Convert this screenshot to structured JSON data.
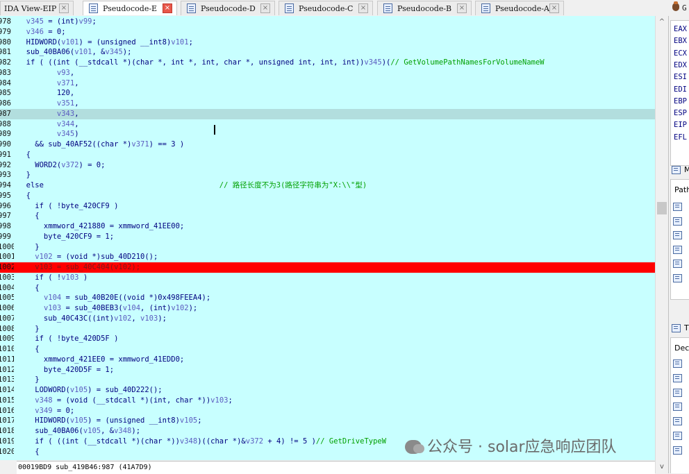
{
  "tabs": [
    {
      "label": "IDA View-EIP",
      "active": false,
      "icon": "none"
    },
    {
      "label": "Pseudocode-E",
      "active": true,
      "icon": "pseudocode-icon"
    },
    {
      "label": "Pseudocode-D",
      "active": false,
      "icon": "pseudocode-icon"
    },
    {
      "label": "Pseudocode-C",
      "active": false,
      "icon": "pseudocode-icon"
    },
    {
      "label": "Pseudocode-B",
      "active": false,
      "icon": "pseudocode-icon"
    },
    {
      "label": "Pseudocode-A",
      "active": false,
      "icon": "pseudocode-icon"
    }
  ],
  "close_glyph": "×",
  "right_top": {
    "label": "G"
  },
  "colors": {
    "code_bg": "#c8ffff",
    "breakpoint_line": "#ff0000",
    "highlight_line": "#b2dede",
    "comment": "#00a000",
    "code_text": "#000080"
  },
  "code_lines": [
    {
      "num": "978",
      "text": "  v345 = (int)v99;",
      "style": "normal"
    },
    {
      "num": "979",
      "text": "  v346 = 0;",
      "style": "normal"
    },
    {
      "num": "980",
      "text": "  HIDWORD(v101) = (unsigned __int8)v101;",
      "style": "normal"
    },
    {
      "num": "981",
      "text": "  sub_40BA06(v101, &v345);",
      "style": "normal"
    },
    {
      "num": "982",
      "text": "  if ( ((int (__stdcall *)(char *, int *, int, char *, unsigned int, int, int))v345)(// GetVolumePathNamesForVolumeNameW",
      "style": "normal"
    },
    {
      "num": "983",
      "text": "         v93,",
      "style": "normal"
    },
    {
      "num": "984",
      "text": "         v371,",
      "style": "normal"
    },
    {
      "num": "985",
      "text": "         120,",
      "style": "normal"
    },
    {
      "num": "986",
      "text": "         v351,",
      "style": "normal"
    },
    {
      "num": "987",
      "text": "         v343,",
      "style": "highlight"
    },
    {
      "num": "988",
      "text": "         v344,",
      "style": "normal"
    },
    {
      "num": "989",
      "text": "         v345)",
      "style": "normal"
    },
    {
      "num": "990",
      "text": "    && sub_40AF52((char *)v371) == 3 )",
      "style": "normal"
    },
    {
      "num": "991",
      "text": "  {",
      "style": "normal"
    },
    {
      "num": "992",
      "text": "    WORD2(v372) = 0;",
      "style": "normal"
    },
    {
      "num": "993",
      "text": "  }",
      "style": "normal"
    },
    {
      "num": "994",
      "text": "  else                                        // 路径长度不为3(路径字符串为\"X:\\\\\"型)",
      "style": "normal"
    },
    {
      "num": "995",
      "text": "  {",
      "style": "normal"
    },
    {
      "num": "996",
      "text": "    if ( !byte_420CF9 )",
      "style": "normal"
    },
    {
      "num": "997",
      "text": "    {",
      "style": "normal"
    },
    {
      "num": "998",
      "text": "      xmmword_421880 = xmmword_41EE00;",
      "style": "normal"
    },
    {
      "num": "999",
      "text": "      byte_420CF9 = 1;",
      "style": "normal"
    },
    {
      "num": "1000",
      "text": "    }",
      "style": "normal"
    },
    {
      "num": "1001",
      "text": "    v102 = (void *)sub_40D210();",
      "style": "normal"
    },
    {
      "num": "1002",
      "text": "    v103 = sub_40C404(v102);",
      "style": "breakpoint"
    },
    {
      "num": "1003",
      "text": "    if ( !v103 )",
      "style": "normal"
    },
    {
      "num": "1004",
      "text": "    {",
      "style": "normal"
    },
    {
      "num": "1005",
      "text": "      v104 = sub_40B20E((void *)0x498FEEA4);",
      "style": "normal"
    },
    {
      "num": "1006",
      "text": "      v103 = sub_40BEB3(v104, (int)v102);",
      "style": "normal"
    },
    {
      "num": "1007",
      "text": "      sub_40C43C((int)v102, v103);",
      "style": "normal"
    },
    {
      "num": "1008",
      "text": "    }",
      "style": "normal"
    },
    {
      "num": "1009",
      "text": "    if ( !byte_420D5F )",
      "style": "normal"
    },
    {
      "num": "1010",
      "text": "    {",
      "style": "normal"
    },
    {
      "num": "1011",
      "text": "      xmmword_421EE0 = xmmword_41EDD0;",
      "style": "normal"
    },
    {
      "num": "1012",
      "text": "      byte_420D5F = 1;",
      "style": "normal"
    },
    {
      "num": "1013",
      "text": "    }",
      "style": "normal"
    },
    {
      "num": "1014",
      "text": "    LODWORD(v105) = sub_40D222();",
      "style": "normal"
    },
    {
      "num": "1015",
      "text": "    v348 = (void (__stdcall *)(int, char *))v103;",
      "style": "normal"
    },
    {
      "num": "1016",
      "text": "    v349 = 0;",
      "style": "normal"
    },
    {
      "num": "1017",
      "text": "    HIDWORD(v105) = (unsigned __int8)v105;",
      "style": "normal"
    },
    {
      "num": "1018",
      "text": "    sub_40BA06(v105, &v348);",
      "style": "normal"
    },
    {
      "num": "1019",
      "text": "    if ( ((int (__stdcall *)(char *))v348)((char *)&v372 + 4) != 5 )// GetDriveTypeW",
      "style": "normal"
    },
    {
      "num": "1020",
      "text": "    {",
      "style": "normal"
    }
  ],
  "status_bar": {
    "text": "00019BD9 sub_419B46:987 (41A7D9)"
  },
  "watermark": {
    "text": "公众号 · solar应急响应团队"
  },
  "registers": [
    "EAX",
    "EBX",
    "ECX",
    "EDX",
    "ESI",
    "EDI",
    "EBP",
    "ESP",
    "EIP",
    "EFL"
  ],
  "right_panels": {
    "modules_header": "M",
    "modules_label": "Path",
    "threads_header": "T",
    "threads_label": "Dec"
  },
  "scroll": {
    "up_glyph": "^",
    "down_glyph": "v",
    "left_glyph": "<"
  }
}
